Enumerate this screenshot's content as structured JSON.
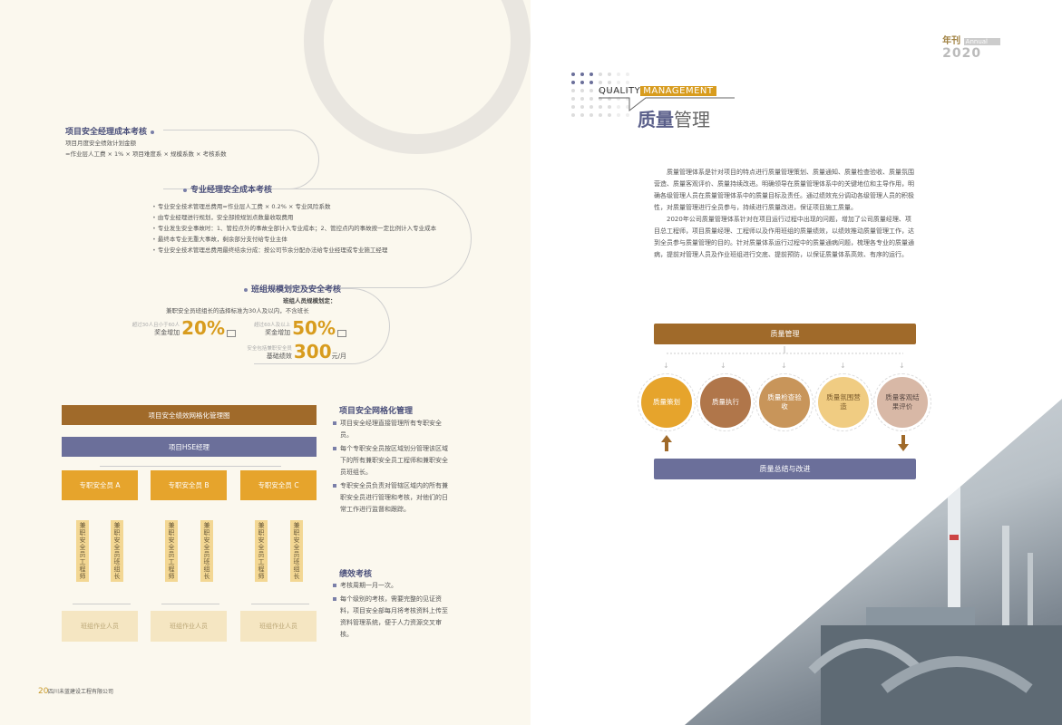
{
  "left": {
    "sec1": {
      "title": "项目安全经理成本考核",
      "line1": "项目月度安全绩效计划金额",
      "line2": "=作业层人工费 × 1% × 项目难度系 × 规模系数 × 考核系数"
    },
    "sec2": {
      "title": "专业经理安全成本考核",
      "items": [
        "专业安全技术管理总费用=作业层人工费 × 0.2% × 专业风险系数",
        "由专业经理进行规划，安全部按规划点数量收取费用",
        "专业发生安全事故时：1、管控点外的事故全部计入专业成本；2、管控点内的事故按一定比例计入专业成本",
        "最终本专业无重大事故，剩余部分支付给专业主体",
        "专业安全技术管理总费用最终结余分成：按公司节余分配办法给专业经理或专业施工经理"
      ]
    },
    "sec3": {
      "title": "班组规模划定及安全考核",
      "subtitle": "班组人员规模划定：",
      "desc": "兼职安全员班组长的选择标准为30人及以内，不含班长",
      "b1": {
        "note": "超过30人且小于60人",
        "label": "奖金增加",
        "value": "20%"
      },
      "b2": {
        "note": "超过60人及以上",
        "label": "奖金增加",
        "value": "50%"
      },
      "b3": {
        "note": "安全包括兼职安全员",
        "label": "基础绩效",
        "value": "300",
        "unit": "元/月"
      }
    },
    "org": {
      "title": "项目安全绩效网格化管理图",
      "hse": "项目HSE经理",
      "officers": [
        "专职安全员 A",
        "专职安全员 B",
        "专职安全员 C"
      ],
      "eng": "兼职安全员工程师",
      "lead": "兼职安全员班组长",
      "workers": "班组作业人员"
    },
    "grid": {
      "title": "项目安全网格化管理",
      "items": [
        "项目安全经理直接管理所有专职安全员。",
        "每个专职安全员按区域划分管理该区域下的所有兼职安全员工程师和兼职安全员班组长。",
        "专职安全员负责对管辖区域内的所有兼职安全员进行管理和考核，对他们的日常工作进行监督和跟踪。"
      ]
    },
    "perf": {
      "title": "绩效考核",
      "items": [
        "考核周期一月一次。",
        "每个级别的考核，需要完整的见证资料，项目安全部每月将考核资料上传至资料管理系统，便于人力资源交叉审核。"
      ]
    },
    "footer": {
      "page": "20",
      "company": "四川未蓝建设工程有限公司"
    }
  },
  "right": {
    "annual": {
      "cn": "年刊",
      "en": "Annual",
      "year": "2020"
    },
    "heading": {
      "en1": "QUALITY",
      "en2": "MANAGEMENT",
      "cn1": "质量",
      "cn2": "管理"
    },
    "para1": "质量管理体系是针对项目的特点进行质量管理策划、质量通知、质量检查验收、质量氛围营造、质量客观评价、质量持续改进。明确领导在质量管理体系中的关键地位和主导作用，明确各级管理人员在质量管理体系中的质量目标及责任。通过绩效充分调动各级管理人员的积极性，对质量管理进行全员参与，持续进行质量改进，保证项目施工质量。",
    "para2": "2020年公司质量管理体系针对在项目运行过程中出现的问题，增加了公司质量经理、项目总工程师，项目质量经理、工程师以及作用班组的质量绩效，以绩效推动质量管理工作，达到全员参与质量管理的目的。针对质量体系运行过程中的质量通病问题，梳理各专业的质量通病，提前对管理人员及作业班组进行交底、提前预防，以保证质量体系高效、有序的运行。",
    "flow": {
      "top": "质量管理",
      "steps": [
        "质量策划",
        "质量执行",
        "质量检查验收",
        "质量氛围营造",
        "质量客观结果评价"
      ],
      "bottom": "质量总结与改进"
    },
    "colors": {
      "gold": "#d89c1e",
      "purple": "#6b6f9a",
      "brown": "#a06a2a"
    }
  }
}
